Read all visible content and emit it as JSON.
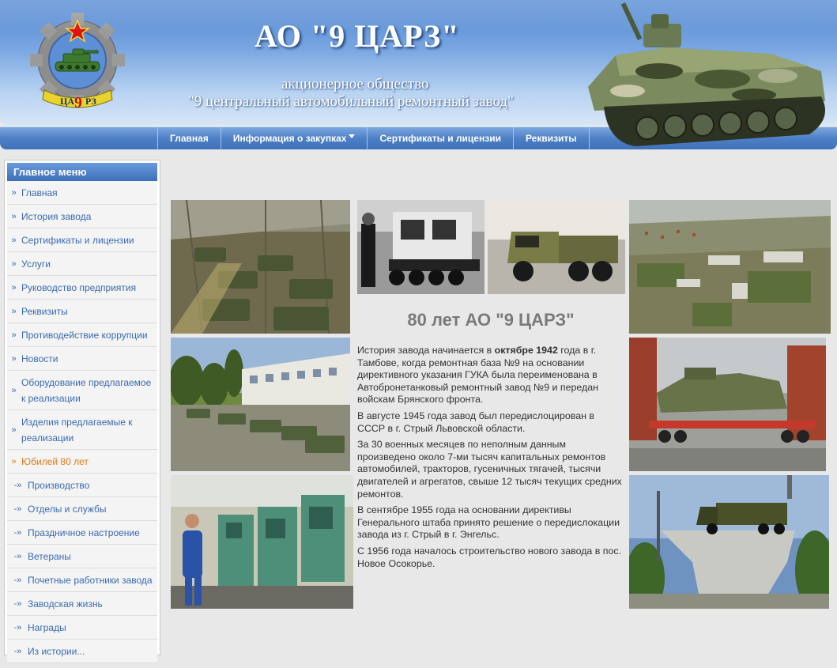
{
  "header": {
    "title": "АО \"9 ЦАРЗ\"",
    "subtitle_line1": "акционерное общество",
    "subtitle_line2": "\"9 центральный автомобильный ремонтный завод\"",
    "logo_text": "ЦА9РЗ"
  },
  "nav": {
    "items": [
      {
        "label": "Главная"
      },
      {
        "label": "Информация о закупках"
      },
      {
        "label": "Сертификаты и лицензии"
      },
      {
        "label": "Реквизиты"
      }
    ]
  },
  "sidebar": {
    "title": "Главное меню",
    "items": [
      {
        "label": "Главная",
        "arrow": "»"
      },
      {
        "label": "История завода",
        "arrow": "»"
      },
      {
        "label": "Сертификаты и лицензии",
        "arrow": "»"
      },
      {
        "label": "Услуги",
        "arrow": "»"
      },
      {
        "label": "Руководство предприятия",
        "arrow": "»"
      },
      {
        "label": "Реквизиты",
        "arrow": "»"
      },
      {
        "label": "Противодействие коррупции",
        "arrow": "»"
      },
      {
        "label": "Новости",
        "arrow": "»"
      },
      {
        "label": "Оборудование предлагаемое к реализации",
        "arrow": "»"
      },
      {
        "label": "Изделия предлагаемые к реализации",
        "arrow": "»"
      },
      {
        "label": "Юбилей 80 лет",
        "arrow": "»",
        "active": true
      },
      {
        "label": "Производство",
        "arrow": "-»"
      },
      {
        "label": "Отделы и службы",
        "arrow": "-»"
      },
      {
        "label": "Праздничное настроение",
        "arrow": "-»"
      },
      {
        "label": "Ветераны",
        "arrow": "-»"
      },
      {
        "label": "Почетные работники завода",
        "arrow": "-»"
      },
      {
        "label": "Заводская жизнь",
        "arrow": "-»"
      },
      {
        "label": "Награды",
        "arrow": "-»"
      },
      {
        "label": "Из истории...",
        "arrow": "-»"
      }
    ]
  },
  "article": {
    "title": "80 лет АО \"9 ЦАРЗ\"",
    "p1_before": "История завода начинается в ",
    "p1_bold": "октябре 1942",
    "p1_after": " года в г. Тамбове, когда ремонтная база №9 на основании директивного указания ГУКА была переименована в Автобронетанковый ремонтный завод №9 и передан войскам Брянского фронта.",
    "p2": "В августе 1945 года завод был передислоцирован в СССР в г. Стрый Львовской области.",
    "p3": "За 30 военных месяцев по неполным данным произведено около 7-ми тысяч капитальных ремонтов автомобилей, тракторов, гусеничных тягачей, тысячи двигателей и агрегатов, свыше 12 тысяч текущих средних ремонтов.",
    "p4": "В сентябре 1955 года на основании директивы Генерального штаба принято решение о передислокации завода из г. Стрый в г. Энгельс.",
    "p5": "С 1956 года началось строительство нового завода в пос. Новое Осокорье."
  },
  "colors": {
    "header_blue": "#4f86d0",
    "nav_blue": "#3f71b9",
    "link_blue": "#3a6ab0",
    "active_orange": "#e07a18"
  }
}
